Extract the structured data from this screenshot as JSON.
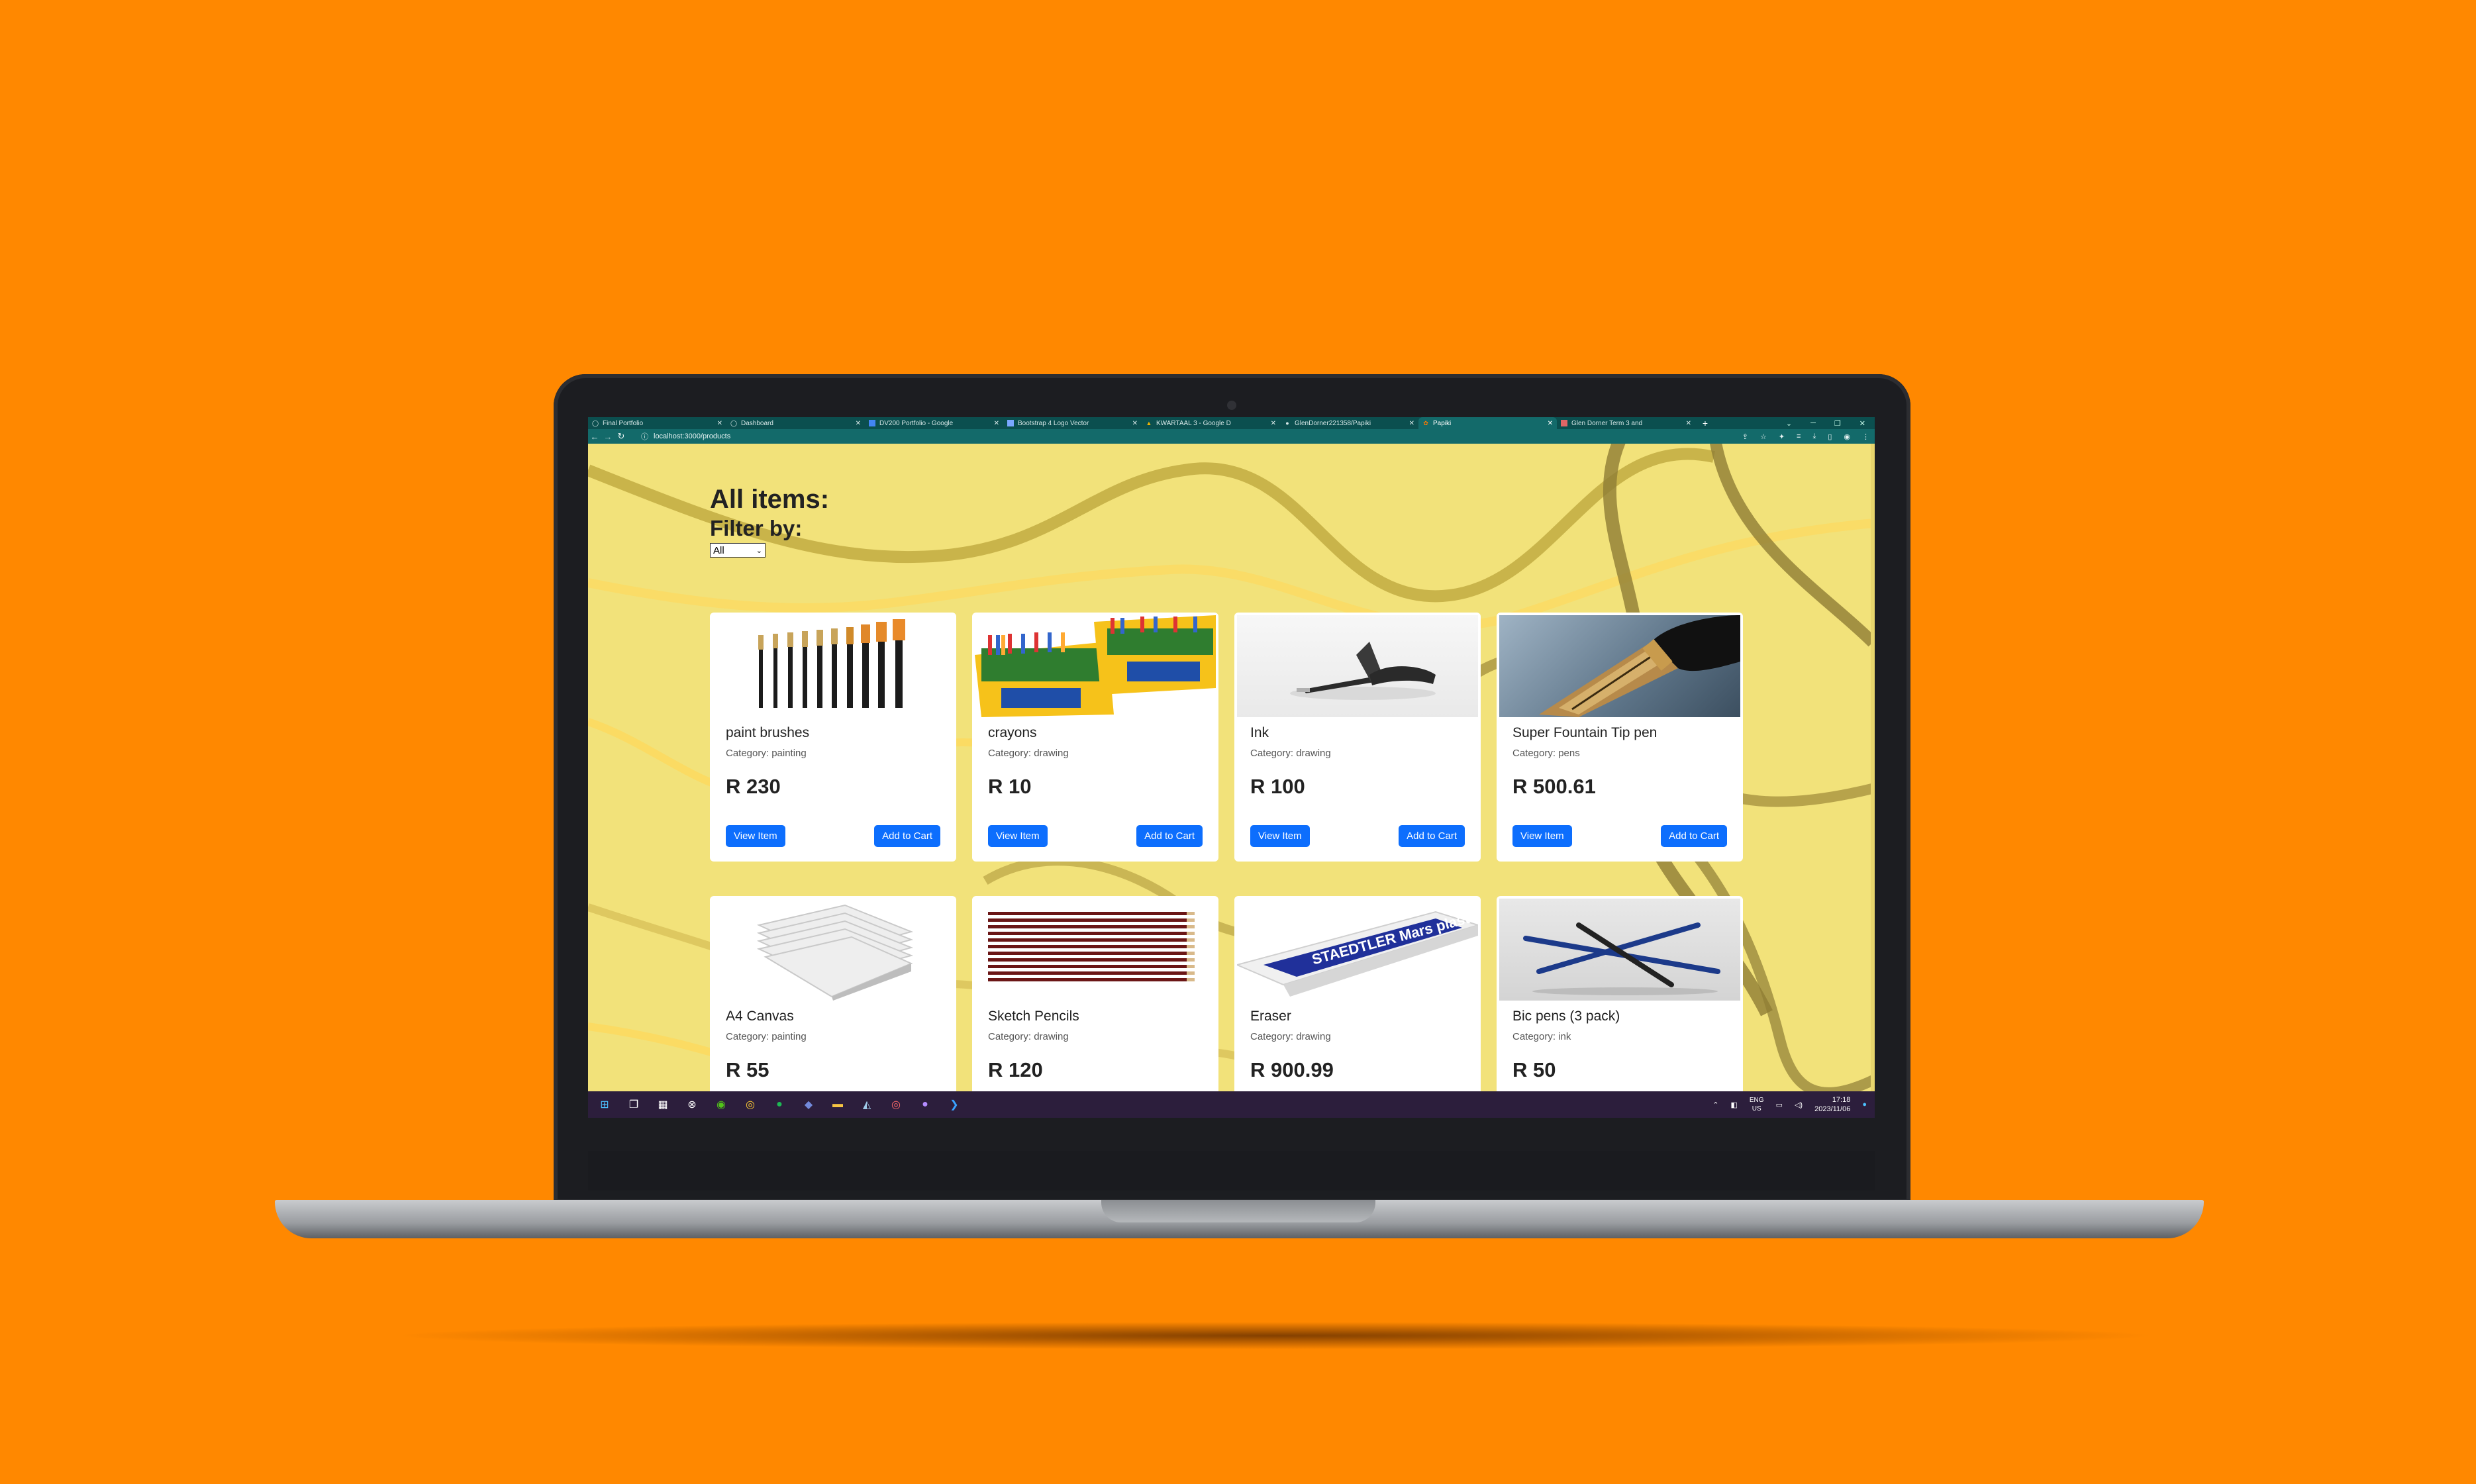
{
  "browser": {
    "tabs": [
      {
        "title": "Final Portfolio",
        "icon": "globe-icon"
      },
      {
        "title": "Dashboard",
        "icon": "globe-icon"
      },
      {
        "title": "DV200 Portfolio - Google",
        "icon": "docs-icon"
      },
      {
        "title": "Bootstrap 4 Logo Vector",
        "icon": "slides-icon"
      },
      {
        "title": "KWARTAAL 3 - Google D",
        "icon": "drive-icon"
      },
      {
        "title": "GlenDorner221358/Papiki",
        "icon": "github-icon"
      },
      {
        "title": "Papiki",
        "icon": "paint-icon",
        "active": true
      },
      {
        "title": "Glen Dorner Term 3 and",
        "icon": "slides-icon"
      }
    ],
    "url": "localhost:3000/products"
  },
  "page": {
    "heading": "All items:",
    "filter_label": "Filter by:",
    "filter_value": "All",
    "view_label": "View Item",
    "cart_label": "Add to Cart",
    "products": [
      {
        "name": "paint brushes",
        "category": "Category: painting",
        "price": "R 230",
        "image": "paint-brushes-image"
      },
      {
        "name": "crayons",
        "category": "Category: drawing",
        "price": "R 10",
        "image": "crayons-image"
      },
      {
        "name": "Ink",
        "category": "Category: drawing",
        "price": "R 100",
        "image": "ink-pen-image"
      },
      {
        "name": "Super Fountain Tip pen",
        "category": "Category: pens",
        "price": "R 500.61",
        "image": "fountain-pen-image"
      },
      {
        "name": "A4 Canvas",
        "category": "Category: painting",
        "price": "R 55",
        "image": "canvas-image"
      },
      {
        "name": "Sketch Pencils",
        "category": "Category: drawing",
        "price": "R 120",
        "image": "pencils-image"
      },
      {
        "name": "Eraser",
        "category": "Category: drawing",
        "price": "R 900.99",
        "image": "eraser-image",
        "brand_text": "STAEDTLER Mars plastic"
      },
      {
        "name": "Bic pens (3 pack)",
        "category": "Category: ink",
        "price": "R 50",
        "image": "pens-image"
      }
    ]
  },
  "taskbar": {
    "lang": "ENG",
    "region": "US",
    "time": "17:18",
    "date": "2023/11/06"
  },
  "colors": {
    "background": "#ff8800",
    "page_bg": "#f2e27a",
    "accent_button": "#0d6efd",
    "browser_frame": "#136a6a"
  }
}
